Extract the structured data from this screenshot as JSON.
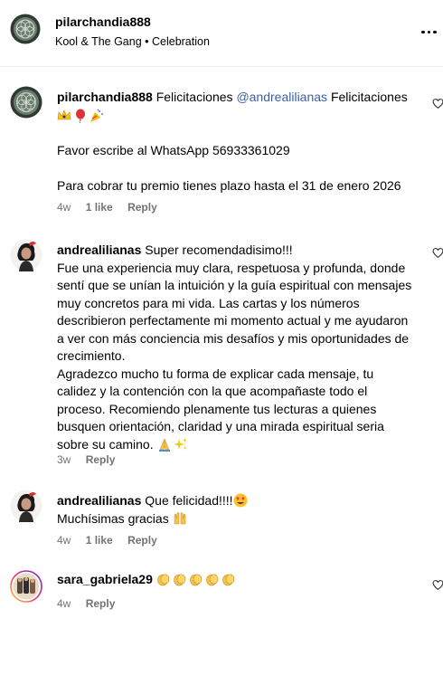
{
  "header": {
    "username": "pilarchandia888",
    "song": "Kool & The Gang • Celebration",
    "more_icon": "more-horizontal-icon"
  },
  "comments": [
    {
      "username": "pilarchandia888",
      "text_a": "Felicitaciones",
      "mention": "@andrealilianas",
      "text_b": "Felicitaciones",
      "emojis": [
        "crown-emoji",
        "balloon-emoji",
        "party-popper-emoji"
      ],
      "para2": "Favor escribe al WhatsApp 56933361029",
      "para3": "Para cobrar tu premio tienes plazo hasta el 31 de enero 2026",
      "time": "4w",
      "likes": "1 like",
      "reply": "Reply"
    },
    {
      "username": "andrealilianas",
      "line1": "Super recomendadisimo!!!",
      "line2": "Fue una experiencia muy clara, respetuosa y profunda, donde",
      "line3": "sentí que se unían la intuición y la guía espiritual con mensajes",
      "line4": "muy concretos para mi vida. Las cartas y los números",
      "line5": "describieron perfectamente mi momento actual y me ayudaron",
      "line6": "a ver con más conciencia mis desafíos y mis oportunidades de",
      "line7": "crecimiento.",
      "line8": "Agradezco mucho tu forma de explicar cada mensaje, tu",
      "line9": "calidez y la contención con la que acompañaste todo el",
      "line10": "proceso. Recomiendo plenamente tus lecturas a quienes",
      "line11": "busquen orientación, claridad y una mirada espiritual seria",
      "line12": "sobre su camino.",
      "emojis": [
        "folded-hands-emoji",
        "sparkles-emoji"
      ],
      "time": "3w",
      "reply": "Reply"
    },
    {
      "username": "andrealilianas",
      "line1": "Que felicidad!!!!",
      "line2": "Muchísimas gracias",
      "emojis": [
        "heart-eyes-emoji",
        "raising-hands-emoji"
      ],
      "time": "4w",
      "likes": "1 like",
      "reply": "Reply"
    },
    {
      "username": "sara_gabriela29",
      "emojis": [
        "clapping-emoji",
        "clapping-emoji",
        "clapping-emoji",
        "clapping-emoji",
        "clapping-emoji"
      ],
      "time": "4w",
      "reply": "Reply"
    }
  ],
  "colors": {
    "mention": "#3b5fa8",
    "meta": "#737373",
    "divider": "#efefef"
  }
}
